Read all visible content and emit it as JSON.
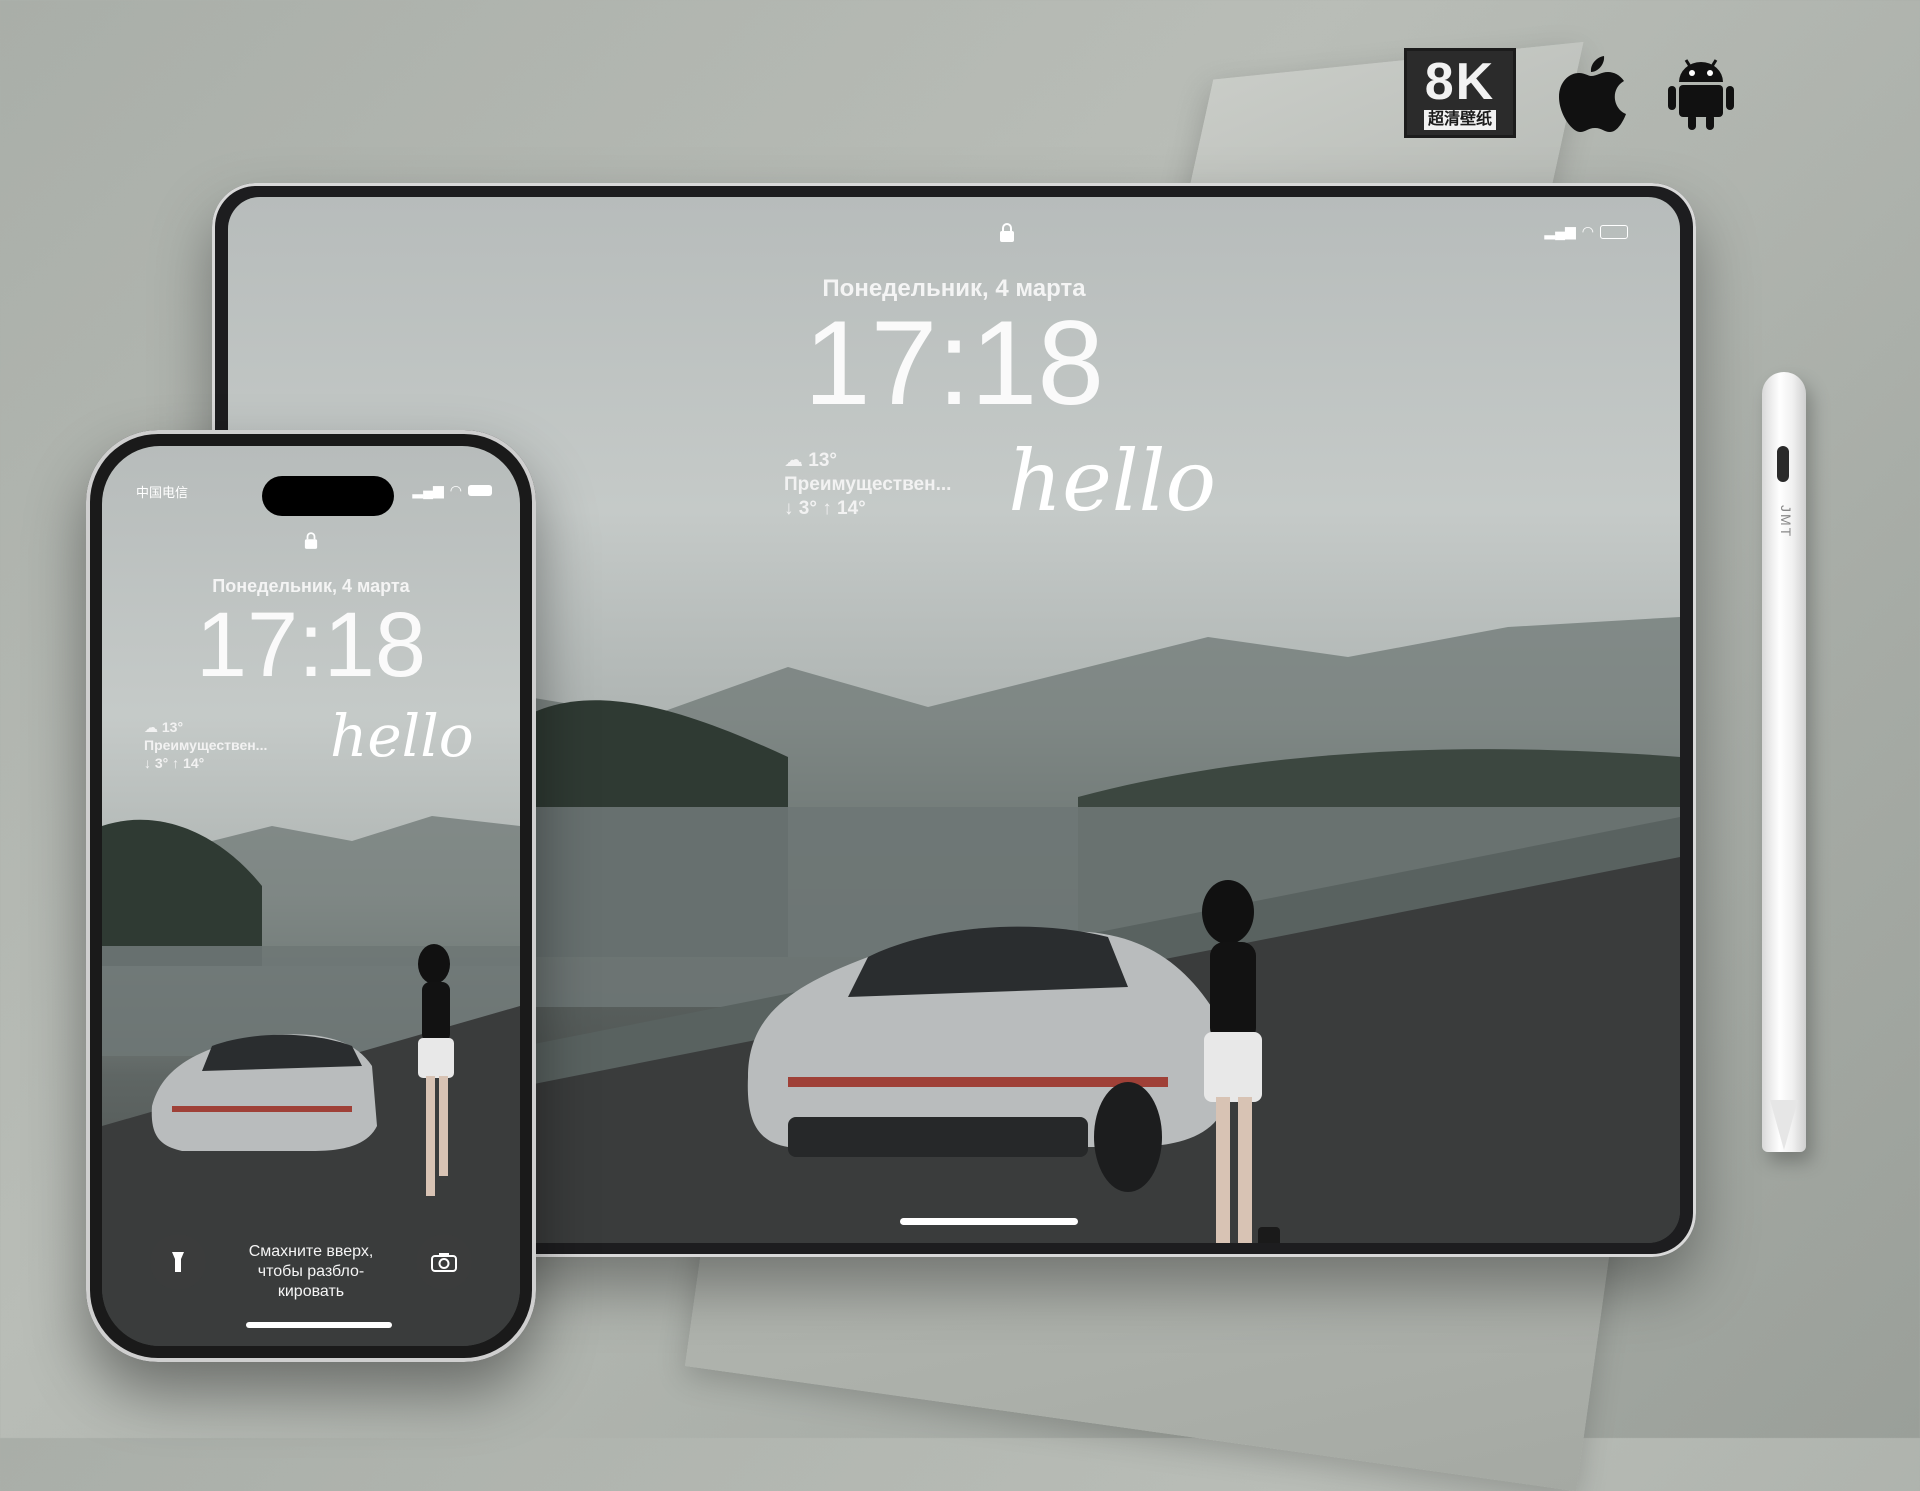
{
  "badges": {
    "hd_big": "8K",
    "hd_small": "超清壁纸"
  },
  "tablet": {
    "date": "Понедельник, 4 марта",
    "time": "17:18",
    "weather_temp": "13°",
    "weather_desc": "Преимуществен...",
    "weather_range": "↓ 3° ↑ 14°",
    "widget_text": "hello"
  },
  "phone": {
    "carrier": "中国电信",
    "date": "Понедельник, 4 марта",
    "time": "17:18",
    "weather_temp": "13°",
    "weather_desc": "Преимуществен...",
    "weather_range": "↓ 3° ↑ 14°",
    "widget_text": "hello",
    "swipe_hint_line1": "Смахните вверх,",
    "swipe_hint_line2": "чтобы разбло-",
    "swipe_hint_line3": "кировать"
  },
  "pencil": {
    "brand": "JMT"
  },
  "icons": {
    "lock": "lock-icon",
    "cloud": "cloud-icon",
    "apple": "apple-icon",
    "android": "android-icon",
    "flashlight": "flashlight-icon",
    "camera": "camera-icon"
  }
}
